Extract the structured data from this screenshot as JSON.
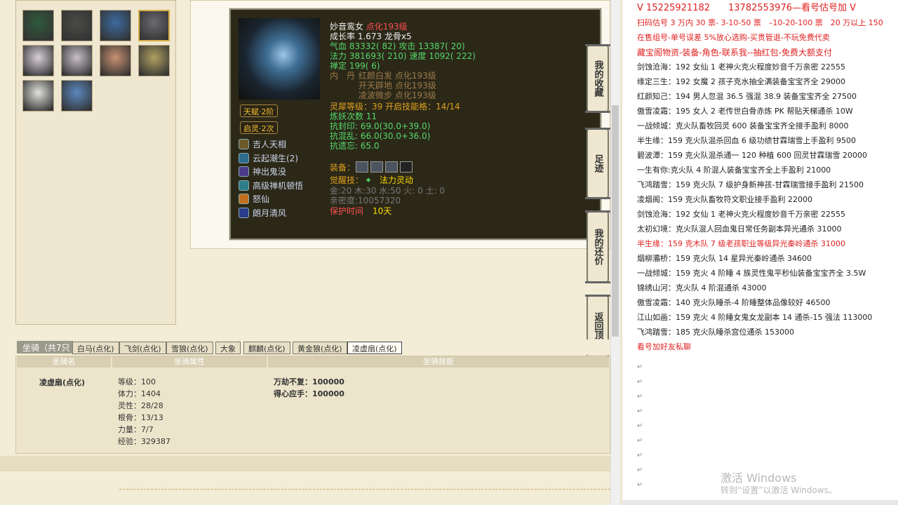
{
  "pets": [
    {
      "name": "pet-1",
      "color": "#2f5a3a"
    },
    {
      "name": "pet-2",
      "color": "#4a4a46"
    },
    {
      "name": "pet-3",
      "color": "#3c6aa0"
    },
    {
      "name": "pet-4",
      "color": "#6a6a70"
    },
    {
      "name": "pet-5",
      "color": "#d8d0d8"
    },
    {
      "name": "pet-6",
      "color": "#c8c0c8"
    },
    {
      "name": "pet-7",
      "color": "#c89070"
    },
    {
      "name": "pet-8",
      "color": "#b0a060"
    },
    {
      "name": "pet-9",
      "color": "#e0e0dc"
    },
    {
      "name": "pet-10",
      "color": "#5a88c0"
    }
  ],
  "pet": {
    "name": "妙音鸾女",
    "name_tag": "点化193级",
    "growth": "成长率 1.673 龙骨x5",
    "hp": "气血 83332( 82) 攻击 13387( 20)",
    "mp": "法力 381693( 210) 速度 1092( 222)",
    "zen": "禅定 199( 6)",
    "neidan_label": "内　丹",
    "neidan": [
      "红颜白发 点化193级",
      "开天辟地 点化193级",
      "凌波微步 点化193级"
    ],
    "spirit": "灵犀等级：39 开启技能格：14/14",
    "refine": "炼妖次数 11",
    "res1": "抗封印: 69.0(30.0+39.0)",
    "res2": "抗混乱: 66.0(30.0+36.0)",
    "res3": "抗遗忘: 65.0",
    "equip_label": "装备：",
    "awaken_label": "觉醒技：",
    "awaken": "法力灵动",
    "elements": "金:20 木:30 水:50 火: 0 土: 0",
    "intimacy": "亲密度:10057320",
    "protect_label": "保护时间",
    "protect": "10天",
    "talent": "天赋·2阶",
    "qiling": "启灵·2次",
    "skills": [
      "吉人天相",
      "云起潮生(2)",
      "神出鬼没",
      "高级禅机顿悟",
      "怒仙",
      "朗月清风"
    ]
  },
  "side_buttons": [
    "我的收藏",
    "足迹",
    "我的还价",
    "返回顶部"
  ],
  "mount": {
    "title": "坐骑（共7只",
    "tabs": [
      "白马(点化)",
      "飞剑(点化)",
      "雪狼(点化)",
      "大象",
      "麒麟(点化)",
      "黄金狼(点化)",
      "凌虚扇(点化)"
    ],
    "headers": [
      "坐骑名",
      "坐骑属性",
      "坐骑技能"
    ],
    "name": "凌虚扇(点化)",
    "attrs": [
      "等级：100",
      "体力：1404",
      "灵性：28/28",
      "根骨：13/13",
      "力量：7/7",
      "经验：329387"
    ],
    "skills": [
      "万劫不复：100000",
      "得心应手：100000"
    ]
  },
  "doc": {
    "lines": [
      {
        "t": "V 15225921182　　13782553976—看号估号加 V",
        "c": "red"
      },
      {
        "t": "扫码估号 3 万内 30 票- 3-10-50 票　–10-20-100 票　20 万以上 150",
        "c": "red"
      },
      {
        "t": "在售组号-单号误差 5%放心选购-买贵管退-不玩免费代卖",
        "c": "red"
      },
      {
        "t": "藏宝阁物资-装备-角色-联系我--抽红包-免费大额支付",
        "c": "red"
      },
      {
        "t": "剑蚀沧海：192 女仙 1 老神火克火程度妙音千万亲密 22555",
        "c": ""
      },
      {
        "t": "缘定三生：192 女魔 2 孩子克水抽全满装备宝宝齐全 29000",
        "c": ""
      },
      {
        "t": "红颜知己：194 男人忽混 36.5 强混 38.9 装备宝宝齐全 27500",
        "c": ""
      },
      {
        "t": "傲雪凌霜：195 女人 2 老传世白骨赤炼 PK 帮贴天梯通杀 10W",
        "c": ""
      },
      {
        "t": "一战倾城：克火队畜牧回灵 600 装备宝宝齐全接手盈利 8000",
        "c": ""
      },
      {
        "t": "半生缘：159 克火队混杀回血 6 级功绩甘霖瑞雪上手盈利 9500",
        "c": ""
      },
      {
        "t": "碧波潭：159 克火队混杀通一 120 种植 600 回灵甘霖瑞雪 20000",
        "c": ""
      },
      {
        "t": "一生有你:克火队 4 阶混人装备宝宝齐全上手盈利 21000",
        "c": ""
      },
      {
        "t": "飞鸿踏雪：159 克火队 7 级护身新神孩-甘霖瑞雪接手盈利 21500",
        "c": ""
      },
      {
        "t": "凌烟阁：159 克火队畜牧符文职业接手盈利 22000",
        "c": ""
      },
      {
        "t": "剑蚀沧海：192 女仙 1 老神火克火程度妙音千万亲密 22555",
        "c": ""
      },
      {
        "t": "太初幻境：克火队混人回血鬼日常任务副本异光通杀 31000",
        "c": ""
      },
      {
        "t": "半生缘：159 克木队 7 级老孩职业等级异光秦岭通杀 31000",
        "c": "red"
      },
      {
        "t": "烟柳灞桥：159 克火队 14 星异光秦岭通杀 34600",
        "c": ""
      },
      {
        "t": "一战倾城：159 克火 4 阶睡 4 族灵性鬼平秒仙装备宝宝齐全 3.5W",
        "c": ""
      },
      {
        "t": "锦绣山河：克火队 4 阶混通杀 43000",
        "c": ""
      },
      {
        "t": "傲雪凌霜：140 克火队睡杀-4 阶睡整体品像较好 46500",
        "c": ""
      },
      {
        "t": "江山如画：159 克火 4 阶睡女鬼女龙副本 14 通杀-15 强法 113000",
        "c": ""
      },
      {
        "t": "飞鸿踏雪：185 克火队睡杀宫位通杀 153000",
        "c": ""
      },
      {
        "t": "看号加好友私聊",
        "c": "red"
      }
    ],
    "watermark1": "激活 Windows",
    "watermark2": "转到“设置”以激活 Windows。"
  }
}
